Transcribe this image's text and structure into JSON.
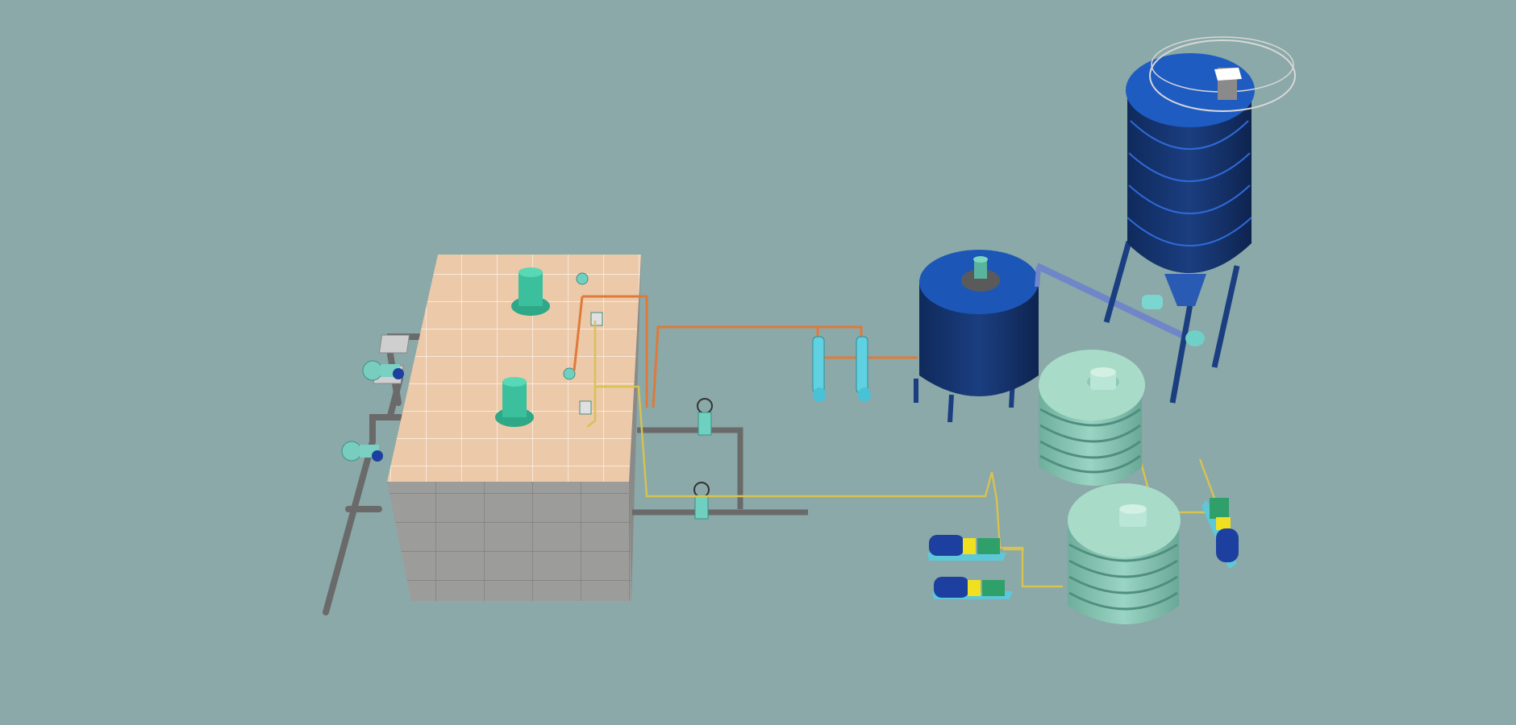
{
  "colors": {
    "background": "#8aa9a8",
    "tile_top": "#ebc7a6",
    "tile_side": "#9a9a98",
    "pipe_gray": "#6e6e6e",
    "pipe_orange": "#e07a3a",
    "pipe_yellow": "#d8c250",
    "tank_blue": "#1c4fa8",
    "tank_blue_dark": "#12306a",
    "tank_mint": "#a8dccb",
    "valve_teal": "#6fd0c0",
    "motor_blue": "#1c3fa0",
    "coupling_yellow": "#f0e020"
  },
  "icons": {
    "pool": "tiled-pool-tank-icon",
    "silo": "storage-silo-icon",
    "mixer": "dosing-mixer-tank-icon",
    "stacked_tank": "stacked-pe-tank-icon",
    "pump": "horizontal-pump-icon",
    "valve": "handwheel-valve-icon"
  }
}
